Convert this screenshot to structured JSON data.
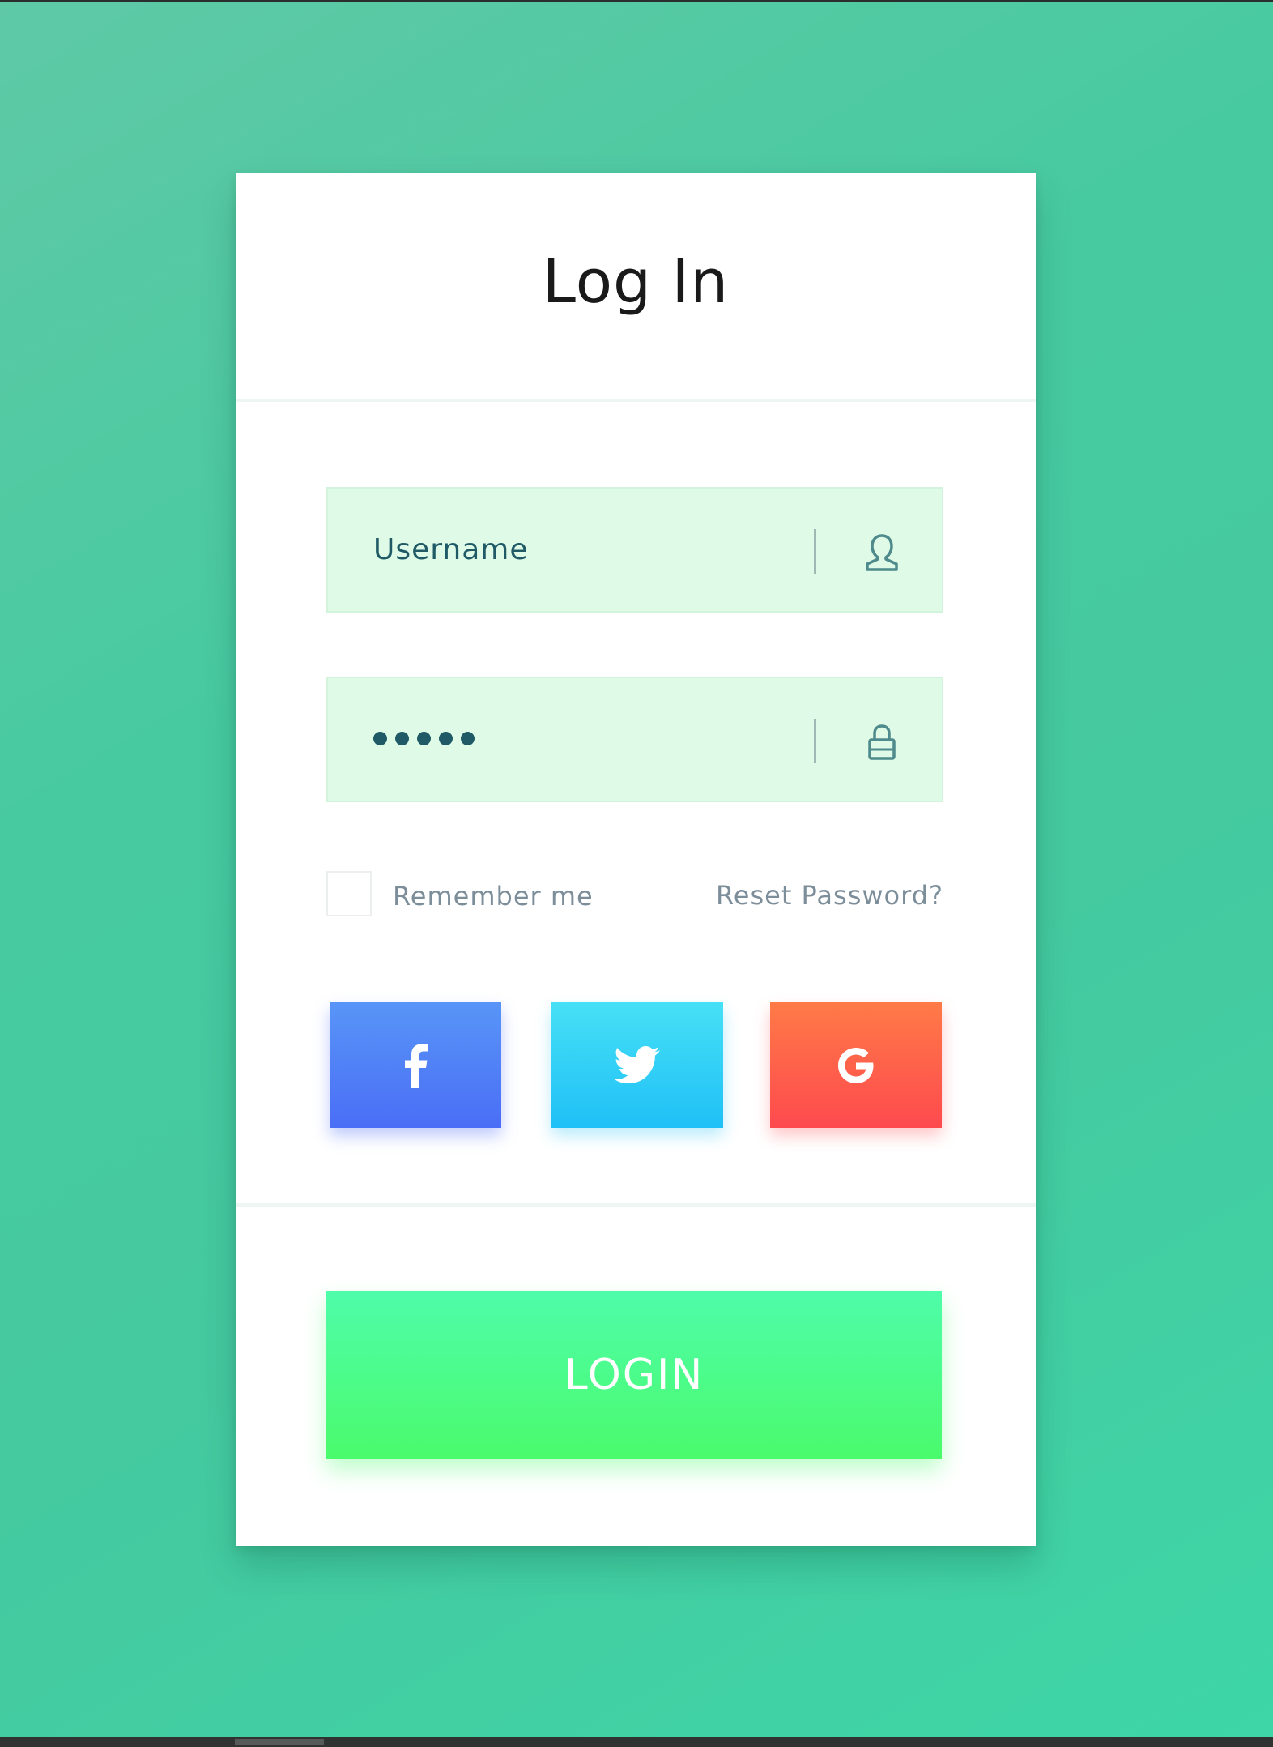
{
  "login_form": {
    "title": "Log In",
    "username": {
      "value": "Username",
      "icon": "user-icon"
    },
    "password": {
      "masked_length": 5,
      "icon": "lock-icon"
    },
    "remember_me": {
      "label": "Remember me",
      "checked": false
    },
    "reset_password_link": "Reset Password?",
    "social_buttons": [
      {
        "network": "facebook",
        "icon": "facebook-icon",
        "color": "#4a6ef6"
      },
      {
        "network": "twitter",
        "icon": "twitter-icon",
        "color": "#1fc0f6"
      },
      {
        "network": "google",
        "icon": "google-icon",
        "color": "#fe4a4e"
      }
    ],
    "login_button_label": "LOGIN"
  },
  "colors": {
    "background": "#46c99f",
    "field_background": "#dffbe7",
    "text_primary": "#1f5a66",
    "muted_text": "#7d8e9b",
    "login_button": "#4afb6c"
  }
}
